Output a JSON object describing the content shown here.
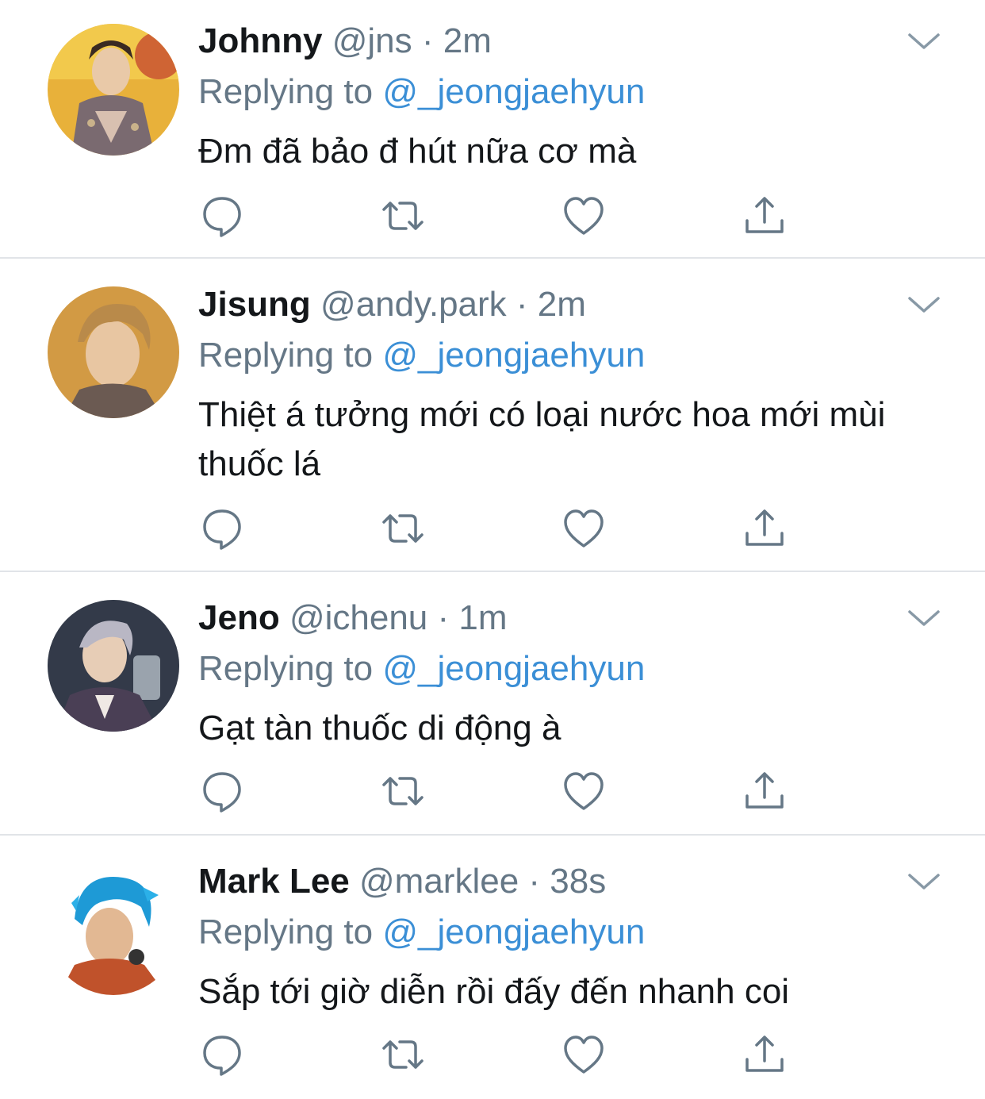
{
  "reply_prefix": "Replying to",
  "icons": {
    "reply": "speech-bubble-icon",
    "retweet": "retweet-icon",
    "like": "heart-icon",
    "share": "share-upload-icon",
    "more": "chevron-down-icon"
  },
  "colors": {
    "text": "#14171a",
    "muted": "#657786",
    "link": "#3b8fd6",
    "divider": "#e1e4e8"
  },
  "tweets": [
    {
      "name": "Johnny",
      "handle": "@jns",
      "separator": "·",
      "time": "2m",
      "replying_to": "@_jeongjaehyun",
      "text": "Đm đã bảo đ hút nữa cơ mà"
    },
    {
      "name": "Jisung",
      "handle": "@andy.park",
      "separator": "·",
      "time": "2m",
      "replying_to": "@_jeongjaehyun",
      "text": "Thiệt á tưởng mới có loại nước hoa mới mùi thuốc lá"
    },
    {
      "name": "Jeno",
      "handle": "@ichenu",
      "separator": "·",
      "time": "1m",
      "replying_to": "@_jeongjaehyun",
      "text": "Gạt tàn thuốc di động à"
    },
    {
      "name": "Mark Lee",
      "handle": "@marklee",
      "separator": "·",
      "time": "38s",
      "replying_to": "@_jeongjaehyun",
      "text": "Sắp tới giờ diễn rồi đấy đến nhanh coi"
    }
  ]
}
